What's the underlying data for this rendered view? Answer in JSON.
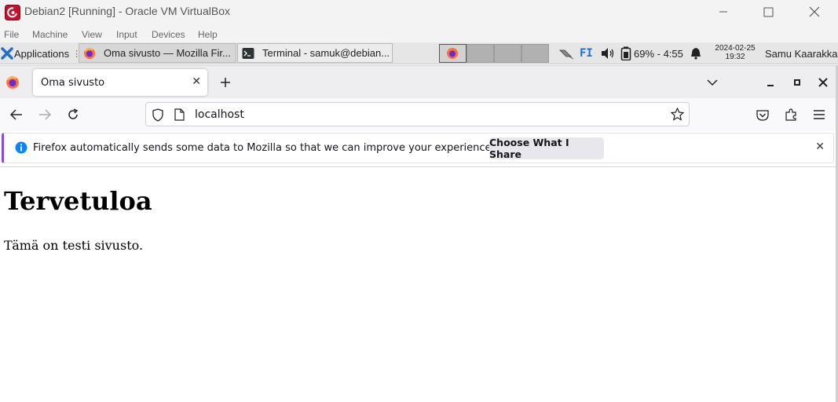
{
  "host_window": {
    "title": "Debian2 [Running] - Oracle VM VirtualBox",
    "menu": [
      "File",
      "Machine",
      "View",
      "Input",
      "Devices",
      "Help"
    ]
  },
  "panel": {
    "applications_label": "Applications",
    "tasks": [
      {
        "label": "Oma sivusto — Mozilla Fir...",
        "icon": "firefox-icon",
        "active": true
      },
      {
        "label": "Terminal - samuk@debian...",
        "icon": "terminal-icon",
        "active": false
      }
    ],
    "keyboard_layout": "FI",
    "battery": "69% - 4:55",
    "date": "2024-02-25",
    "time": "19:32",
    "user": "Samu Kaarakka"
  },
  "browser": {
    "tab_title": "Oma sivusto",
    "url": "localhost",
    "notification": {
      "message": "Firefox automatically sends some data to Mozilla so that we can improve your experience.",
      "button": "Choose What I Share"
    }
  },
  "page": {
    "heading": "Tervetuloa",
    "paragraph": "Tämä on testi sivusto."
  },
  "colors": {
    "notification_accent": "#8a4bd3",
    "info_icon": "#0a84ff"
  }
}
